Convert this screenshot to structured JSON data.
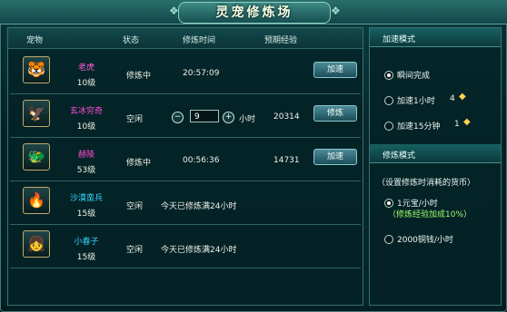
{
  "window": {
    "title": "灵宠修炼场"
  },
  "table": {
    "headers": {
      "pet": "宠物",
      "status": "状态",
      "time": "修炼时间",
      "exp": "预期经验"
    },
    "rows": [
      {
        "name": "老虎",
        "level": "10级",
        "status": "修炼中",
        "time": "20:57:09",
        "exp": "",
        "button": "加速",
        "name_color": "#ff59d8"
      },
      {
        "name": "玄冰穷奇",
        "level": "10级",
        "status": "空闲",
        "time_input": "9",
        "time_unit": "小时",
        "exp": "20314",
        "button": "修炼",
        "name_color": "#ff4dd2"
      },
      {
        "name": "赫陵",
        "level": "53级",
        "status": "修炼中",
        "time": "00:56:36",
        "exp": "14731",
        "button": "加速",
        "name_color": "#ff4dd2"
      },
      {
        "name": "沙漠蛮兵",
        "level": "15级",
        "status": "空闲",
        "message": "今天已修炼满24小时",
        "name_color": "#37d7ff"
      },
      {
        "name": "小春子",
        "level": "15级",
        "status": "空闲",
        "message": "今天已修炼满24小时",
        "name_color": "#3bd4ff"
      }
    ]
  },
  "speed_mode": {
    "title": "加速模式",
    "options": [
      {
        "label": "瞬间完成",
        "selected": true
      },
      {
        "label": "加速1小时",
        "count": "4"
      },
      {
        "label": "加速15分钟",
        "count": "1"
      }
    ]
  },
  "train_mode": {
    "title": "修炼模式",
    "hint": "（设置修炼时消耗的货币）",
    "options": [
      {
        "label": "1元宝/小时",
        "note": "（修炼经验加成10%）",
        "selected": true
      },
      {
        "label": "2000铜钱/小时"
      }
    ]
  },
  "icons": {
    "pet_1": "tiger-avatar-icon",
    "pet_2": "ice-beast-avatar-icon",
    "pet_3": "green-beast-avatar-icon",
    "pet_4": "desert-warrior-avatar-icon",
    "pet_5": "child-avatar-icon",
    "ingot": "gold-ingot-icon"
  }
}
